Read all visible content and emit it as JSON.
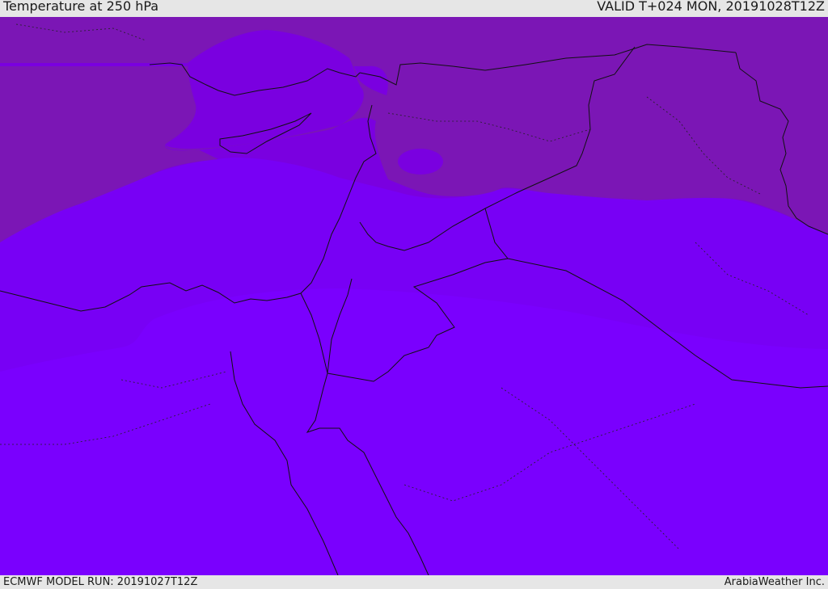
{
  "header": {
    "title": "Temperature at 250 hPa",
    "valid_time": "VALID T+024 MON, 20191028T12Z"
  },
  "footer": {
    "model_run": "ECMWF MODEL RUN: 20191027T12Z",
    "credit": "ArabiaWeather Inc."
  },
  "colors": {
    "band_coldest": "#7b16b5",
    "band_cold": "#7a00e0",
    "band_mid": "#7800f5",
    "band_warm": "#7a00fe",
    "boundary": "#111111"
  }
}
